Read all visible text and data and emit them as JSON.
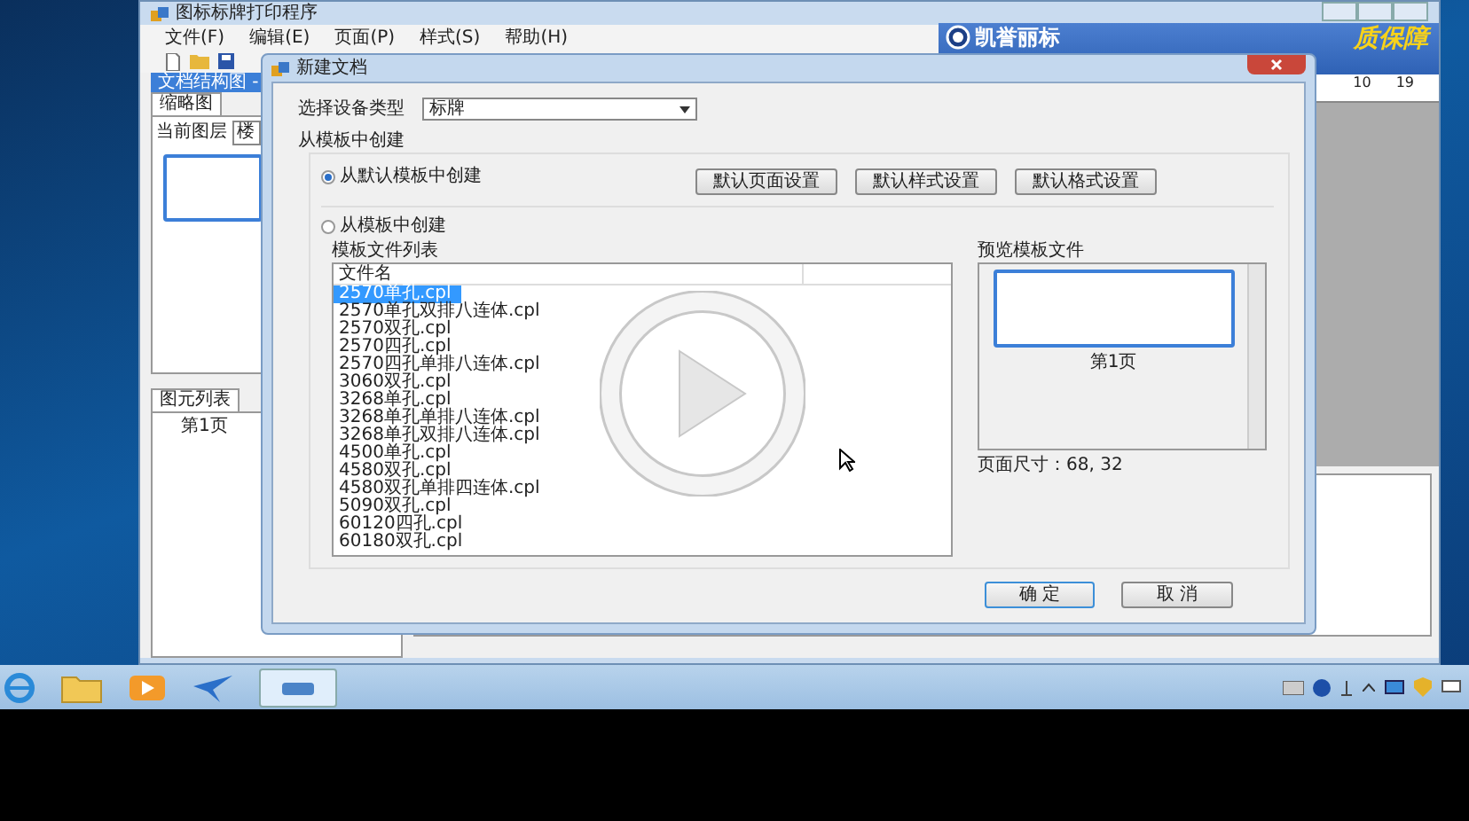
{
  "app_window": {
    "title": "图标标牌打印程序",
    "menu": [
      "文件(F)",
      "编辑(E)",
      "页面(P)",
      "样式(S)",
      "帮助(H)"
    ]
  },
  "left_panel": {
    "header": "文档结构图 -",
    "tabs": [
      {
        "label": "缩略图",
        "selected": true
      }
    ],
    "layer_label": "当前图层",
    "layer_value": "楼",
    "element_tab": "图元列表",
    "element_items": [
      "第1页"
    ]
  },
  "banner": {
    "brand": "凯誉丽标",
    "slogan": "质保障"
  },
  "ruler": [
    "10",
    "19"
  ],
  "dialog": {
    "title": "新建文档",
    "device_label": "选择设备类型",
    "device_value": "标牌",
    "group_label": "从模板中创建",
    "options": [
      {
        "label": "从默认模板中创建",
        "selected": true
      },
      {
        "label": "从模板中创建",
        "selected": false
      }
    ],
    "default_buttons": [
      "默认页面设置",
      "默认样式设置",
      "默认格式设置"
    ],
    "list_label": "模板文件列表",
    "list_header": "文件名",
    "files": [
      {
        "name": "2570单孔.cpl",
        "selected": true
      },
      {
        "name": "2570单孔双排八连体.cpl",
        "selected": false
      },
      {
        "name": "2570双孔.cpl",
        "selected": false
      },
      {
        "name": "2570四孔.cpl",
        "selected": false
      },
      {
        "name": "2570四孔单排八连体.cpl",
        "selected": false
      },
      {
        "name": "3060双孔.cpl",
        "selected": false
      },
      {
        "name": "3268单孔.cpl",
        "selected": false
      },
      {
        "name": "3268单孔单排八连体.cpl",
        "selected": false
      },
      {
        "name": "3268单孔双排八连体.cpl",
        "selected": false
      },
      {
        "name": "4500单孔.cpl",
        "selected": false
      },
      {
        "name": "4580双孔.cpl",
        "selected": false
      },
      {
        "name": "4580双孔单排四连体.cpl",
        "selected": false
      },
      {
        "name": "5090双孔.cpl",
        "selected": false
      },
      {
        "name": "60120四孔.cpl",
        "selected": false
      },
      {
        "name": "60180双孔.cpl",
        "selected": false
      }
    ],
    "preview_label": "预览模板文件",
    "preview_page": "第1页",
    "page_size": "页面尺寸：68, 32",
    "ok": "确 定",
    "cancel": "取 消"
  }
}
